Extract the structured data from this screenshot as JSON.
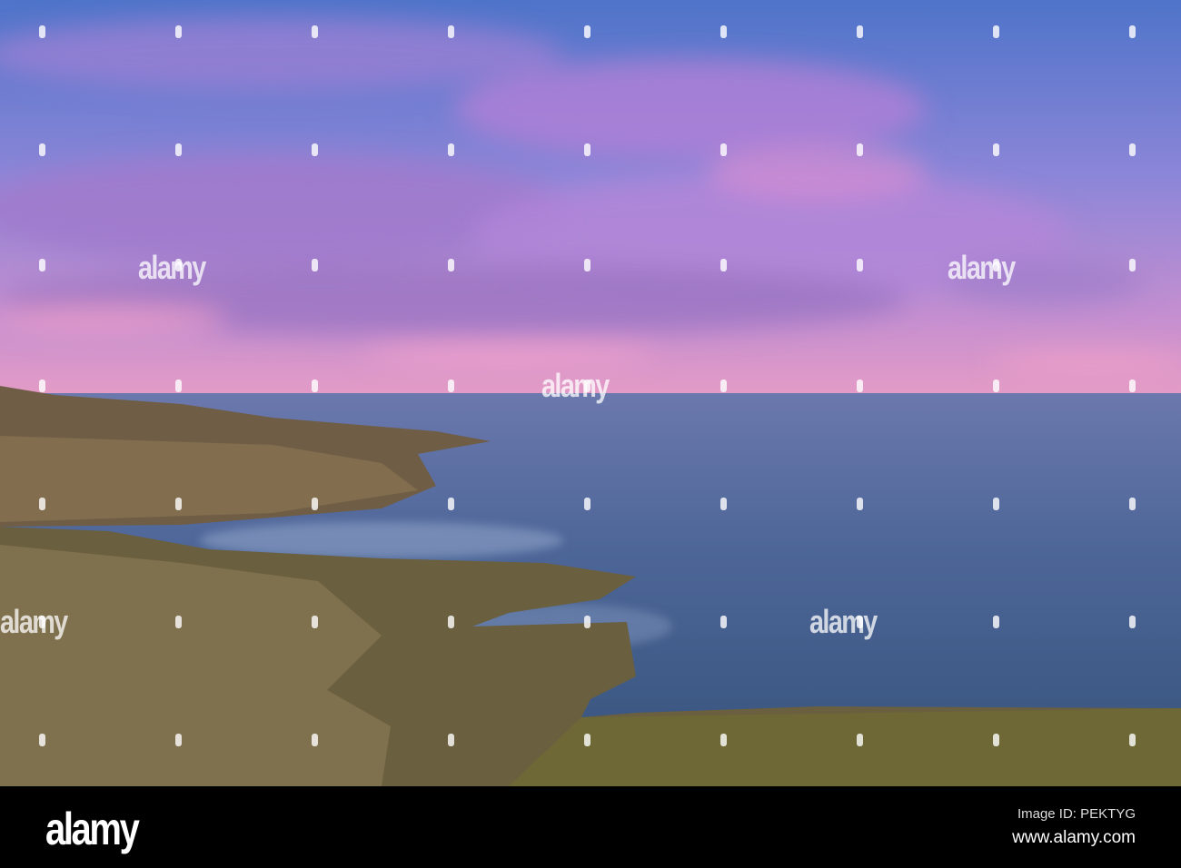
{
  "photo": {
    "description_alt": "",
    "colors": {
      "sky_top": "#4f78cf",
      "cloud": "#a884d6",
      "pink": "#e79ac8",
      "sea": "#4b6695",
      "rock": "#7a6a4a"
    }
  },
  "watermark": {
    "text": "alamy"
  },
  "footer": {
    "logo": "alamy",
    "image_id": "Image ID: PEKTYG",
    "url": "www.alamy.com"
  }
}
